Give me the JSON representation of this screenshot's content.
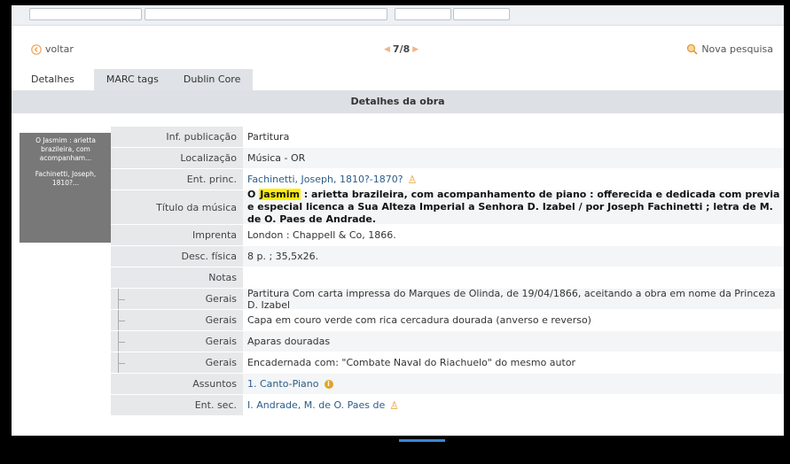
{
  "nav": {
    "back_label": "voltar",
    "pager": "7/8",
    "new_search_label": "Nova pesquisa"
  },
  "tabs": [
    {
      "label": "Detalhes"
    },
    {
      "label": "MARC tags"
    },
    {
      "label": "Dublin Core"
    }
  ],
  "section_title": "Detalhes da obra",
  "thumbnail": {
    "title": "O Jasmim : arietta brazileira, com acompanham...",
    "author": "Fachinetti, Joseph, 1810?..."
  },
  "details": {
    "pub_info": {
      "label": "Inf. publicação",
      "value": "Partitura"
    },
    "location": {
      "label": "Localização",
      "value": "Música - OR"
    },
    "main_entry": {
      "label": "Ent. princ.",
      "value": "Fachinetti, Joseph, 1810?-1870?"
    },
    "music_title": {
      "label": "Título da música",
      "prefix": "O ",
      "highlight": "Jasmim",
      "rest": " : arietta brazileira, com acompanhamento de piano : offerecida e dedicada com previa e especial licenca a Sua Alteza Imperial a Senhora D. Izabel / por Joseph Fachinetti ; letra de M. de O. Paes de Andrade."
    },
    "imprint": {
      "label": "Imprenta",
      "value": "London : Chappell & Co, 1866."
    },
    "physical": {
      "label": "Desc. física",
      "value": "8 p. ; 35,5x26."
    },
    "notes": {
      "label": "Notas",
      "value": ""
    },
    "general_notes": [
      {
        "label": "Gerais",
        "value": "Partitura Com carta impressa do Marques de Olinda, de 19/04/1866, aceitando a obra em nome da Princeza D. Izabel"
      },
      {
        "label": "Gerais",
        "value": "Capa em couro verde com rica cercadura dourada (anverso e reverso)"
      },
      {
        "label": "Gerais",
        "value": "Aparas douradas"
      },
      {
        "label": "Gerais",
        "value": "Encadernada com: \"Combate Naval do Riachuelo\" do mesmo autor"
      }
    ],
    "subjects": {
      "label": "Assuntos",
      "value": "1. Canto-Piano"
    },
    "secondary_entry": {
      "label": "Ent. sec.",
      "value": "I. Andrade, M. de O. Paes de"
    }
  }
}
